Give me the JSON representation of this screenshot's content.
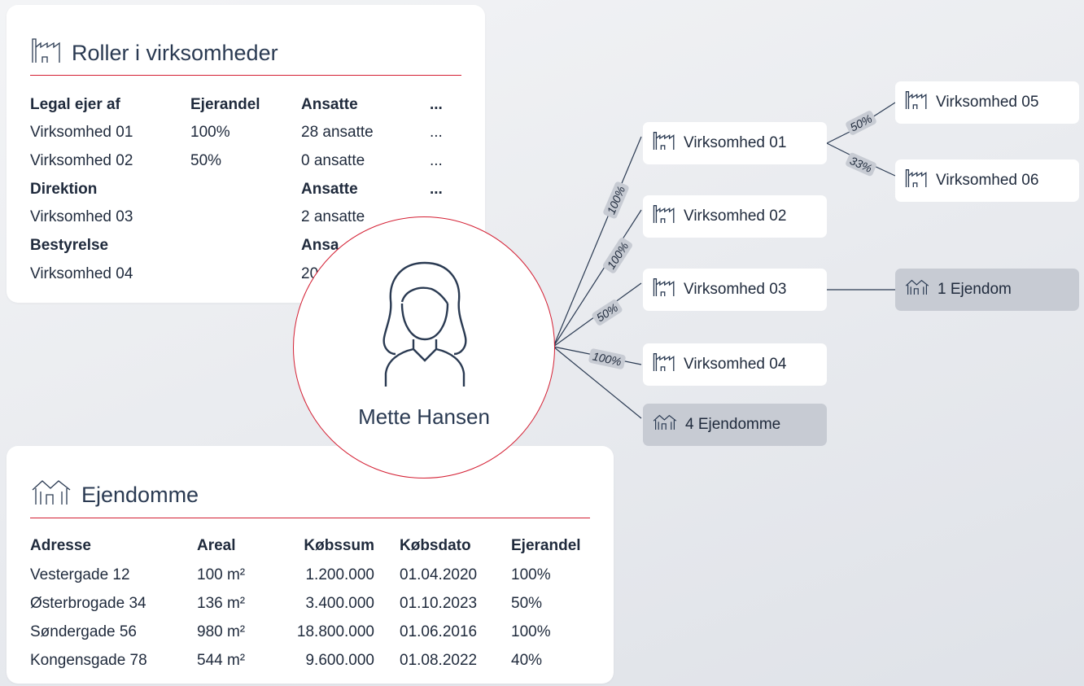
{
  "roles": {
    "title": "Roller i virksomheder",
    "icon": "factory-icon",
    "sections": [
      {
        "headers": [
          "Legal ejer af",
          "Ejerandel",
          "Ansatte",
          "..."
        ],
        "rows": [
          [
            "Virksomhed 01",
            "100%",
            "28 ansatte",
            "..."
          ],
          [
            "Virksomhed 02",
            "50%",
            "0 ansatte",
            "..."
          ]
        ]
      },
      {
        "headers": [
          "Direktion",
          "",
          "Ansatte",
          "..."
        ],
        "rows": [
          [
            "Virksomhed 03",
            "",
            "2 ansatte",
            ""
          ]
        ]
      },
      {
        "headers": [
          "Bestyrelse",
          "",
          "Ansa",
          ""
        ],
        "rows": [
          [
            "Virksomhed 04",
            "",
            "20",
            ""
          ]
        ]
      }
    ]
  },
  "properties": {
    "title": "Ejendomme",
    "icon": "houses-icon",
    "headers": [
      "Adresse",
      "Areal",
      "Købssum",
      "Købsdato",
      "Ejerandel"
    ],
    "rows": [
      [
        "Vestergade 12",
        "100 m²",
        "1.200.000",
        "01.04.2020",
        "100%"
      ],
      [
        "Østerbrogade 34",
        "136 m²",
        "3.400.000",
        "01.10.2023",
        "50%"
      ],
      [
        "Søndergade 56",
        "980 m²",
        "18.800.000",
        "01.06.2016",
        "100%"
      ],
      [
        "Kongensgade 78",
        "544 m²",
        "9.600.000",
        "01.08.2022",
        "40%"
      ]
    ]
  },
  "person": {
    "name": "Mette Hansen",
    "icon": "person-icon"
  },
  "nodes": {
    "v01": "Virksomhed 01",
    "v02": "Virksomhed 02",
    "v03": "Virksomhed 03",
    "v04": "Virksomhed 04",
    "v05": "Virksomhed 05",
    "v06": "Virksomhed 06",
    "ejendom1": "1 Ejendom",
    "ejendomme4": "4 Ejendomme"
  },
  "ownership": {
    "p_v01": "100%",
    "p_v02": "100%",
    "p_v03": "50%",
    "p_v04": "100%",
    "p_v05": "50%",
    "p_v06": "33%"
  },
  "colors": {
    "accent": "#d41f33",
    "text": "#1f2a3c",
    "gray_node": "#c7cbd3"
  }
}
